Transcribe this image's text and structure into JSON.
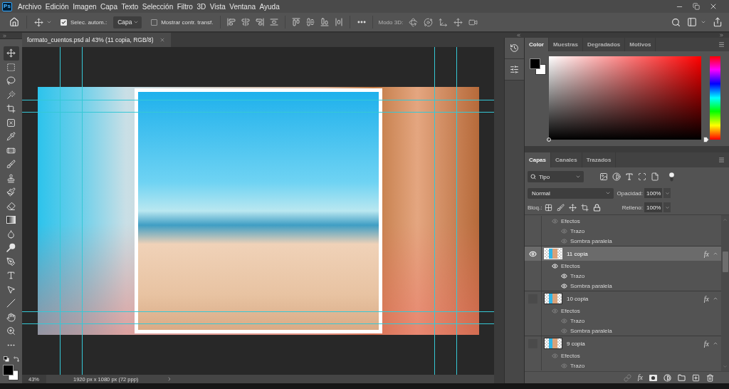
{
  "app": {
    "logo": "Ps"
  },
  "menu": [
    "Archivo",
    "Edición",
    "Imagen",
    "Capa",
    "Texto",
    "Selección",
    "Filtro",
    "3D",
    "Vista",
    "Ventana",
    "Ayuda"
  ],
  "options_bar": {
    "auto_select": {
      "label": "Selec. autom.:",
      "checked": true
    },
    "target": {
      "value": "Capa"
    },
    "show_transform": {
      "label": "Mostrar contr. transf.",
      "checked": false
    },
    "mode_3d": {
      "label": "Modo 3D:",
      "disabled": true
    }
  },
  "document_tab": {
    "title": "formato_cuentos.psd al 43% (11 copia, RGB/8)"
  },
  "tools": [
    {
      "kind": "move",
      "selected": true
    },
    {
      "kind": "marquee",
      "selected": false
    },
    {
      "kind": "lasso",
      "selected": false
    },
    {
      "kind": "magic_wand",
      "selected": false
    },
    {
      "kind": "crop",
      "selected": false
    },
    {
      "kind": "frame",
      "selected": false
    },
    {
      "kind": "eyedropper",
      "selected": false
    },
    {
      "kind": "healing",
      "selected": false
    },
    {
      "kind": "brush",
      "selected": false
    },
    {
      "kind": "stamp",
      "selected": false
    },
    {
      "kind": "history_brush",
      "selected": false
    },
    {
      "kind": "eraser",
      "selected": false
    },
    {
      "kind": "gradient",
      "selected": false
    },
    {
      "kind": "blur",
      "selected": false
    },
    {
      "kind": "dodge",
      "selected": false
    },
    {
      "kind": "pen",
      "selected": false
    },
    {
      "kind": "type",
      "selected": false
    },
    {
      "kind": "path_select",
      "selected": false
    },
    {
      "kind": "line",
      "selected": false
    },
    {
      "kind": "hand",
      "selected": false
    },
    {
      "kind": "zoom",
      "selected": false
    },
    {
      "kind": "more",
      "selected": false
    }
  ],
  "status_bar": {
    "zoom": "43%",
    "document_size": "1920 px x 1080 px (72 ppp)"
  },
  "color_panel": {
    "tabs": [
      {
        "label": "Color",
        "selected": true
      },
      {
        "label": "Muestras",
        "selected": false
      },
      {
        "label": "Degradados",
        "selected": false
      },
      {
        "label": "Motivos",
        "selected": false
      }
    ],
    "hue_slider": {
      "level": 0
    }
  },
  "layers_panel": {
    "tabs": [
      {
        "label": "Capas",
        "selected": true
      },
      {
        "label": "Canales",
        "selected": false
      },
      {
        "label": "Trazados",
        "selected": false
      }
    ],
    "filter": {
      "value": "Tipo",
      "on": true
    },
    "blend_mode": {
      "value": "Normal"
    },
    "opacity": {
      "label": "Opacidad:",
      "value": "100%"
    },
    "lock": {
      "label": "Bloq.:"
    },
    "fill": {
      "label": "Relleno:",
      "value": "100%"
    },
    "rows": [
      {
        "kind": "effects",
        "label": "Efectos",
        "visible": false,
        "children": [
          {
            "label": "Trazo"
          },
          {
            "label": "Sombra paralela"
          }
        ]
      },
      {
        "kind": "layer",
        "name": "11 copia",
        "visible": true,
        "selected": true,
        "expanded": true,
        "badge": "fx",
        "children": [
          {
            "label": "Efectos",
            "visible": true,
            "children": [
              {
                "label": "Trazo"
              },
              {
                "label": "Sombra paralela"
              }
            ]
          }
        ]
      },
      {
        "kind": "layer",
        "name": "10 copia",
        "visible": false,
        "selected": false,
        "expanded": true,
        "badge": "fx",
        "children": [
          {
            "label": "Efectos",
            "visible": false,
            "children": [
              {
                "label": "Trazo"
              },
              {
                "label": "Sombra paralela"
              }
            ]
          }
        ]
      },
      {
        "kind": "layer",
        "name": "9 copia",
        "visible": false,
        "selected": false,
        "expanded": true,
        "badge": "fx",
        "children": [
          {
            "label": "Efectos",
            "visible": false,
            "children": [
              {
                "label": "Trazo"
              }
            ]
          }
        ]
      }
    ],
    "fx_button": {
      "label": "fx"
    }
  }
}
